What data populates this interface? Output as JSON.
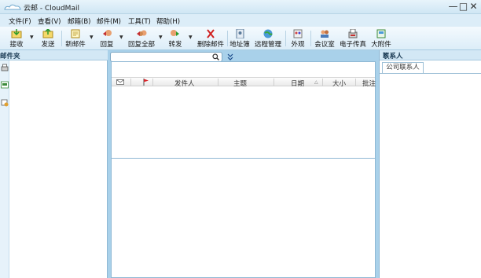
{
  "window": {
    "title": "云邮 - CloudMail",
    "minimize": "—",
    "maximize": "□",
    "close": "✕"
  },
  "menu": [
    {
      "label": "文件(F)"
    },
    {
      "label": "查看(V)"
    },
    {
      "label": "邮箱(B)"
    },
    {
      "label": "邮件(M)"
    },
    {
      "label": "工具(T)"
    },
    {
      "label": "帮助(H)"
    }
  ],
  "toolbar": [
    {
      "label": "接收",
      "icon": "receive-icon",
      "dropdown": true
    },
    {
      "label": "发送",
      "icon": "send-icon",
      "dropdown": false
    },
    {
      "label": "新邮件",
      "icon": "new-mail-icon",
      "dropdown": true
    },
    {
      "label": "回复",
      "icon": "reply-icon",
      "dropdown": true
    },
    {
      "label": "回复全部",
      "icon": "reply-all-icon",
      "dropdown": true
    },
    {
      "label": "转发",
      "icon": "forward-icon",
      "dropdown": true
    },
    {
      "label": "删除邮件",
      "icon": "delete-icon",
      "dropdown": false
    },
    {
      "label": "地址簿",
      "icon": "address-book-icon",
      "dropdown": false
    },
    {
      "label": "远程管理",
      "icon": "remote-manage-icon",
      "dropdown": false
    },
    {
      "label": "外观",
      "icon": "appearance-icon",
      "dropdown": false
    },
    {
      "label": "会议室",
      "icon": "meeting-room-icon",
      "dropdown": false
    },
    {
      "label": "电子传真",
      "icon": "fax-icon",
      "dropdown": false
    },
    {
      "label": "大附件",
      "icon": "large-attachment-icon",
      "dropdown": false
    }
  ],
  "left_panel": {
    "title": "邮件夹"
  },
  "search": {
    "value": "",
    "placeholder": ""
  },
  "columns": [
    "发件人",
    "主题",
    "日期",
    "大小",
    "批注"
  ],
  "right_panel": {
    "title": "联系人",
    "close": "×",
    "tab": "公司联系人"
  },
  "colors": {
    "accent": "#a9d1ea",
    "header": "#d3e8f5",
    "flag": "#d8262b"
  }
}
